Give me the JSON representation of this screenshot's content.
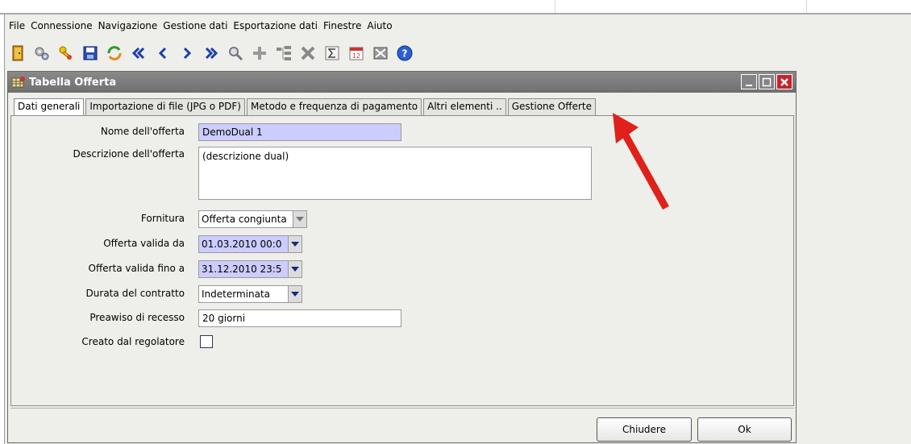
{
  "menubar": [
    "File",
    "Connessione",
    "Navigazione",
    "Gestione dati",
    "Esportazione dati",
    "Finestre",
    "Aiuto"
  ],
  "toolbar_icons": [
    "exit-door-icon",
    "gears-icon",
    "keys-icon",
    "save-disk-icon",
    "refresh-icon",
    "first-record-icon",
    "previous-record-icon",
    "next-record-icon",
    "last-record-icon",
    "search-icon",
    "add-icon",
    "tree-icon",
    "delete-icon",
    "sum-icon",
    "calendar-icon",
    "export-icon",
    "help-icon"
  ],
  "window": {
    "title": "Tabella Offerta"
  },
  "tabs": [
    "Dati generali",
    "Importazione di file (JPG o PDF)",
    "Metodo e frequenza di pagamento",
    "Altri elementi  ..",
    "Gestione Offerte"
  ],
  "form": {
    "nome_label": "Nome dell'offerta",
    "nome_value": "DemoDual 1",
    "descrizione_label": "Descrizione dell'offerta",
    "descrizione_value": "(descrizione dual)",
    "fornitura_label": "Fornitura",
    "fornitura_value": "Offerta congiunta",
    "valida_da_label": "Offerta valida da",
    "valida_da_value": "01.03.2010 00:0",
    "valida_fino_label": "Offerta valida fino a",
    "valida_fino_value": "31.12.2010 23:5",
    "durata_label": "Durata del contratto",
    "durata_value": "Indeterminata",
    "preavviso_label": "Preawiso di recesso",
    "preavviso_value": "20 giorni",
    "creato_label": "Creato dal regolatore",
    "creato_checked": false
  },
  "buttons": {
    "close": "Chiudere",
    "ok": "Ok"
  },
  "colors": {
    "arrow": "#e0201a",
    "lavender_field": "#ccccff",
    "titlebar": "#7a7a7a"
  }
}
